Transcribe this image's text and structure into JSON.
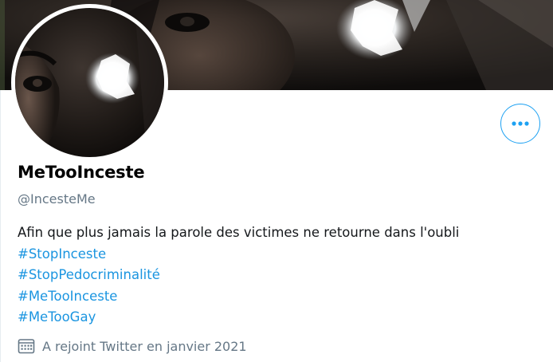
{
  "profile": {
    "display_name": "MeTooInceste",
    "handle": "@IncesteMe",
    "bio_text": "Afin que plus jamais la parole des victimes ne retourne dans l'oubli",
    "hashtags": [
      "#StopInceste",
      "#StopPedocriminalité",
      "#MeTooInceste",
      "#MeTooGay"
    ],
    "joined": "A rejoint Twitter en janvier 2021"
  },
  "icons": {
    "more": "more-horizontal-icon",
    "calendar": "calendar-icon"
  },
  "colors": {
    "accent": "#1da1f2",
    "hashtag": "#1b95e0",
    "secondary_text": "#657786",
    "primary_text": "#14171a"
  }
}
